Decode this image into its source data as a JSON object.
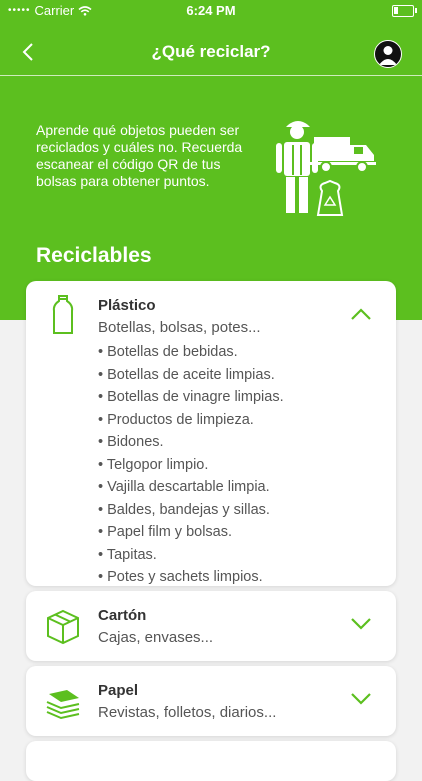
{
  "status": {
    "carrier": "Carrier",
    "time": "6:24 PM"
  },
  "header": {
    "title": "¿Qué reciclar?"
  },
  "intro": {
    "text": "Aprende qué objetos pueden ser reciclados y cuáles no. Recuerda escanear el código QR de tus bolsas para obtener puntos."
  },
  "section": {
    "title": "Reciclables"
  },
  "categories": [
    {
      "name": "Plástico",
      "subtitle": "Botellas, bolsas, potes...",
      "items": [
        "• Botellas de bebidas.",
        "• Botellas de aceite limpias.",
        "• Botellas de vinagre limpias.",
        "• Productos de limpieza.",
        "• Bidones.",
        "• Telgopor limpio.",
        "• Vajilla descartable limpia.",
        "• Baldes, bandejas y sillas.",
        "• Papel film y bolsas.",
        "• Tapitas.",
        "• Potes y sachets limpios."
      ]
    },
    {
      "name": "Cartón",
      "subtitle": "Cajas, envases..."
    },
    {
      "name": "Papel",
      "subtitle": "Revistas, folletos, diarios..."
    }
  ],
  "colors": {
    "accent": "#5cbf1f",
    "background": "#f2f2f2"
  }
}
